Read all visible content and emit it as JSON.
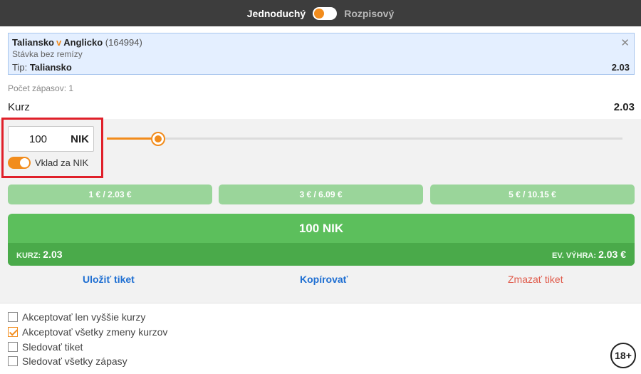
{
  "topbar": {
    "mode_simple": "Jednoduchý",
    "mode_system": "Rozpisový"
  },
  "bet": {
    "home": "Taliansko",
    "vs": "v",
    "away": "Anglicko",
    "event_id": "(164994)",
    "market": "Stávka bez remízy",
    "tip_label": "Tip:",
    "tip_value": "Taliansko",
    "odd": "2.03",
    "close_icon": "close-icon"
  },
  "summary": {
    "count_label": "Počet zápasov: 1",
    "kurz_label": "Kurz",
    "kurz_value": "2.03"
  },
  "stake": {
    "amount": "100",
    "currency": "NIK",
    "toggle_label": "Vklad za NIK",
    "slider_fraction": 0.1
  },
  "quick_stakes": [
    "1 € / 2.03 €",
    "3 € / 6.09 €",
    "5 € / 10.15 €"
  ],
  "place": {
    "amount_label": "100 NIK",
    "kurz_label": "KURZ:",
    "kurz_value": "2.03",
    "win_label": "EV. VÝHRA:",
    "win_value": "2.03 €"
  },
  "actions": {
    "save": "Uložiť tiket",
    "copy": "Kopírovať",
    "delete": "Zmazať tiket"
  },
  "options": [
    {
      "label": "Akceptovať len vyššie kurzy",
      "checked": false
    },
    {
      "label": "Akceptovať všetky zmeny kurzov",
      "checked": true
    },
    {
      "label": "Sledovať tiket",
      "checked": false
    },
    {
      "label": "Sledovať všetky zápasy",
      "checked": false
    }
  ],
  "age_badge": "18+",
  "colors": {
    "accent": "#f28c1c",
    "green": "#5cbf5c",
    "link": "#1f6fd2",
    "danger": "#e05a4a",
    "highlight": "#e0202a"
  }
}
